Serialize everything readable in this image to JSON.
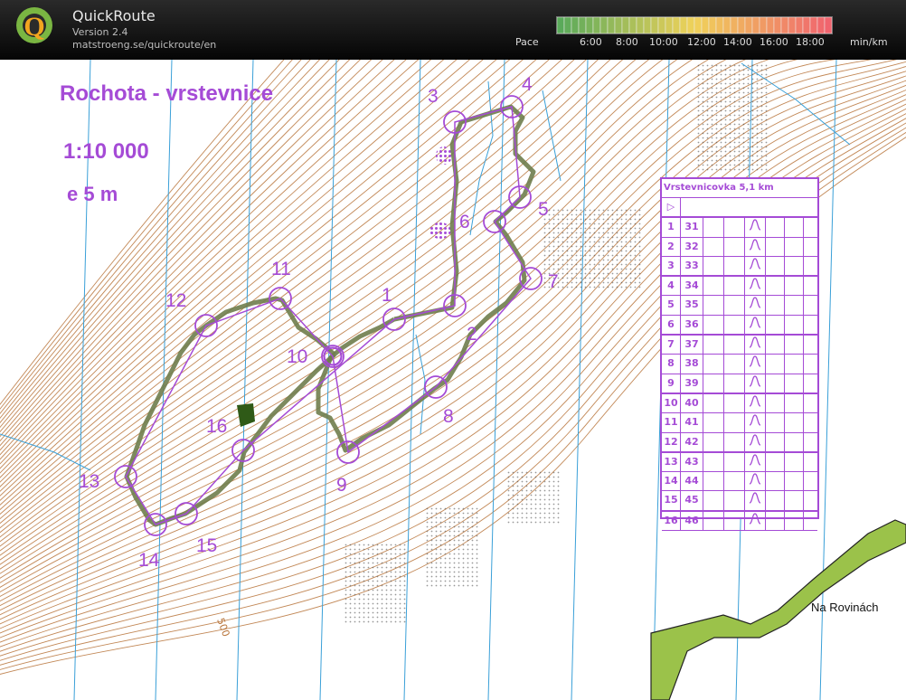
{
  "header": {
    "app_title": "QuickRoute",
    "version": "Version 2.4",
    "url": "matstroeng.se/quickroute/en",
    "pace_label": "Pace",
    "pace_ticks": [
      "6:00",
      "8:00",
      "10:00",
      "12:00",
      "14:00",
      "16:00",
      "18:00"
    ],
    "pace_unit": "min/km"
  },
  "map": {
    "title": "Rochota - vrstevnice",
    "scale": "1:10 000",
    "contour": "e 5 m",
    "place_name": "Na Rovinách",
    "contour_value": "500",
    "controls": [
      "1",
      "2",
      "3",
      "4",
      "5",
      "6",
      "7",
      "8",
      "9",
      "10",
      "11",
      "12",
      "13",
      "14",
      "15",
      "16"
    ]
  },
  "description": {
    "title": "Vrstevnicovka  5,1 km",
    "start_symbol": "▷",
    "rows": [
      {
        "n": "1",
        "code": "31"
      },
      {
        "n": "2",
        "code": "32"
      },
      {
        "n": "3",
        "code": "33"
      },
      {
        "n": "4",
        "code": "34"
      },
      {
        "n": "5",
        "code": "35"
      },
      {
        "n": "6",
        "code": "36"
      },
      {
        "n": "7",
        "code": "37"
      },
      {
        "n": "8",
        "code": "38"
      },
      {
        "n": "9",
        "code": "39"
      },
      {
        "n": "10",
        "code": "40"
      },
      {
        "n": "11",
        "code": "41"
      },
      {
        "n": "12",
        "code": "42"
      },
      {
        "n": "13",
        "code": "43"
      },
      {
        "n": "14",
        "code": "44"
      },
      {
        "n": "15",
        "code": "45"
      },
      {
        "n": "16",
        "code": "46"
      }
    ]
  },
  "colors": {
    "course": "#a54bd6",
    "route": "#6f7d4c",
    "contour": "#b8743a",
    "water": "#3aa0d8",
    "green": "#9bc24a"
  }
}
